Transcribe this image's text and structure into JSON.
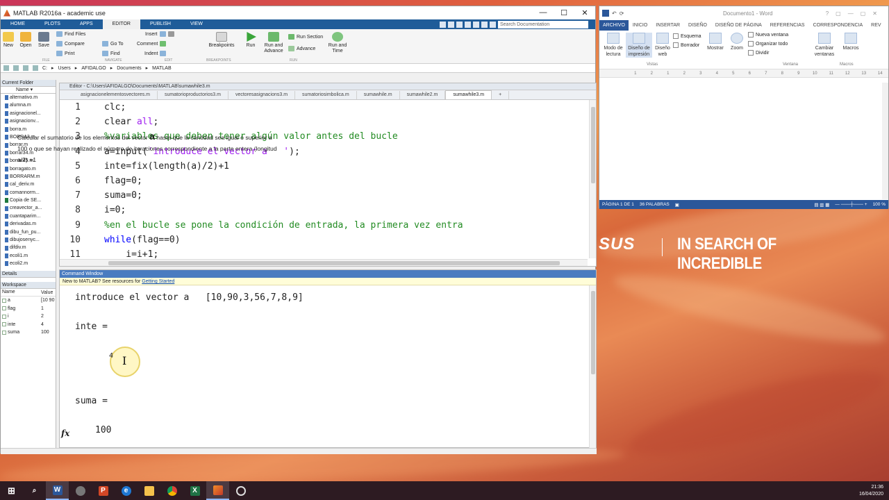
{
  "matlab": {
    "title": "MATLAB R2016a - academic use",
    "tabs": [
      "HOME",
      "PLOTS",
      "APPS",
      "EDITOR",
      "PUBLISH",
      "VIEW"
    ],
    "search_placeholder": "Search Documentation",
    "ribbon": {
      "new": "New",
      "open": "Open",
      "save": "Save",
      "find_files": "Find Files",
      "compare": "Compare",
      "print": "Print",
      "go_to": "Go To",
      "find": "Find",
      "insert": "Insert",
      "comment": "Comment",
      "indent": "Indent",
      "breakpoints": "Breakpoints",
      "run": "Run",
      "run_and_advance": "Run and\nAdvance",
      "run_section": "Run Section",
      "advance": "Advance",
      "run_and_time": "Run and\nTime",
      "groups": [
        "FILE",
        "NAVIGATE",
        "EDIT",
        "BREAKPOINTS",
        "RUN"
      ]
    },
    "path": [
      "C:",
      "Users",
      "AFIDALGO",
      "Documents",
      "MATLAB"
    ],
    "current_folder": {
      "header": "Current Folder",
      "col": "Name",
      "files": [
        "alternativo.m",
        "alumna.m",
        "asignacionel...",
        "asignacionv...",
        "borra.m",
        "BORRA3.m",
        "borrar.m",
        "borrar34.m",
        "borrar45.m",
        "borragato.m",
        "BORRARM.m",
        "cal_deriv.m",
        "comannorm...",
        "Copia de SE...",
        "creavector_a...",
        "cuantaparim...",
        "derivadas.m",
        "dibu_fun_pu...",
        "dibujosenyc...",
        "difdiv.m",
        "ecoli1.m",
        "ecoli2.m"
      ]
    },
    "details_label": "Details",
    "workspace": {
      "header": "Workspace",
      "cols": [
        "Name",
        "Value"
      ],
      "vars": [
        {
          "name": "a",
          "value": "[10 90"
        },
        {
          "name": "flag",
          "value": "1"
        },
        {
          "name": "i",
          "value": "2"
        },
        {
          "name": "inte",
          "value": "4"
        },
        {
          "name": "suma",
          "value": "100"
        }
      ]
    },
    "editor": {
      "title": "Editor - C:\\Users\\AFIDALGO\\Documents\\MATLAB\\sumawhile3.m",
      "tabs": [
        "asignacionelementosvectores.m",
        "sumatorioproductorios3.m",
        "vectoresasignacions3.m",
        "sumatoriosimbolica.m",
        "sumawhile.m",
        "sumawhile2.m",
        "sumawhile3.m"
      ],
      "active_tab": "sumawhile3.m",
      "lines": [
        {
          "n": "1",
          "code": "clc;"
        },
        {
          "n": "2",
          "code": "clear all;"
        },
        {
          "n": "3",
          "code": "%variables que deben tener algún valor antes del bucle"
        },
        {
          "n": "4",
          "code": "a=input('introduce el vector a   ');"
        },
        {
          "n": "5",
          "code": "inte=fix(length(a)/2)+1"
        },
        {
          "n": "6",
          "code": "flag=0;"
        },
        {
          "n": "7",
          "code": "suma=0;"
        },
        {
          "n": "8",
          "code": "i=0;"
        },
        {
          "n": "9",
          "code": "%en el bucle se pone la condición de entrada, la primera vez entra"
        },
        {
          "n": "10",
          "code": "while(flag==0)"
        },
        {
          "n": "11",
          "code": "    i=i+1;"
        }
      ]
    },
    "command_window": {
      "title": "Command Window",
      "banner_text": "New to MATLAB? See resources for ",
      "banner_link": "Getting Started",
      "prompt_line": "introduce el vector a   [10,90,3,56,7,8,9]",
      "inte_label": "inte =",
      "inte_value": "4",
      "suma_label": "suma =",
      "suma_value": "100",
      "fx": "fx"
    }
  },
  "word": {
    "title": "Documento1 - Word",
    "tabs": [
      "ARCHIVO",
      "INICIO",
      "INSERTAR",
      "DISEÑO",
      "DISEÑO DE PÁGINA",
      "REFERENCIAS",
      "CORRESPONDENCIA",
      "REV"
    ],
    "ribbon": {
      "modo_lectura": "Modo de\nlectura",
      "diseno_impresion": "Diseño de\nimpresión",
      "diseno_web": "Diseño\nweb",
      "esquema": "Esquema",
      "borrador": "Borrador",
      "mostrar": "Mostrar",
      "zoom": "Zoom",
      "nueva_ventana": "Nueva ventana",
      "organizar_todo": "Organizar todo",
      "dividir": "Dividir",
      "cambiar_ventanas": "Cambiar\nventanas",
      "macros": "Macros",
      "group_vistas": "Vistas",
      "group_ventana": "Ventana",
      "group_macros": "Macros"
    },
    "ruler": [
      "1",
      "2",
      "1",
      "2",
      "3",
      "4",
      "5",
      "6",
      "7",
      "8",
      "9",
      "10",
      "11",
      "12",
      "13",
      "14"
    ],
    "doc_text_1": "Calcular el sumatorio de los elementos del vector ",
    "doc_var": "a",
    "doc_text_2": " hasta que la cantidad sea igual o superior a 100 o que se hayan realizado el número de iteraciones correspondiente a la parte entera (longitud a/2) +1",
    "status_page": "PÁGINA 1 DE 1",
    "status_words": "36 PALABRAS",
    "zoom": "100 %"
  },
  "desktop": {
    "slogan": "IN SEARCH OF INCREDIBLE",
    "logo": "SUS"
  },
  "taskbar": {
    "time": "21:36",
    "date": "16/04/2020"
  }
}
